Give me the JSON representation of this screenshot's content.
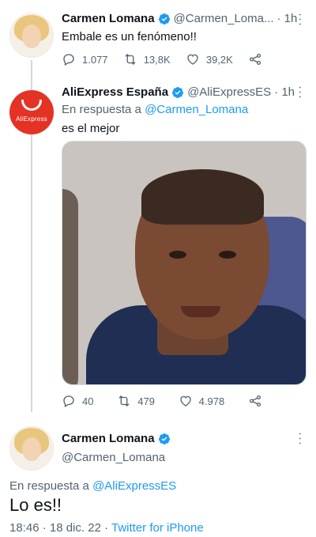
{
  "tweet1": {
    "name": "Carmen Lomana",
    "handle": "@Carmen_Loma...",
    "time": "· 1h",
    "text": "Embale es un fenómeno!!",
    "replies": "1.077",
    "retweets": "13,8K",
    "likes": "39,2K"
  },
  "tweet2": {
    "name": "AliExpress España",
    "handle": "@AliExpressES",
    "time": "· 1h",
    "reply_prefix": "En respuesta a",
    "reply_to": "@Carmen_Lomana",
    "text": "es el mejor",
    "avatar_brand": "AliExpress",
    "replies": "40",
    "retweets": "479",
    "likes": "4.978"
  },
  "tweet3": {
    "name": "Carmen Lomana",
    "handle": "@Carmen_Lomana",
    "reply_prefix": "En respuesta a",
    "reply_to": "@AliExpressES",
    "text": "Lo es!!",
    "date": "18:46 · 18 dic. 22 ·",
    "source": "Twitter for iPhone"
  },
  "colors": {
    "accent": "#1d9bf0",
    "muted": "#536471",
    "aliexpress_red": "#e43225"
  }
}
